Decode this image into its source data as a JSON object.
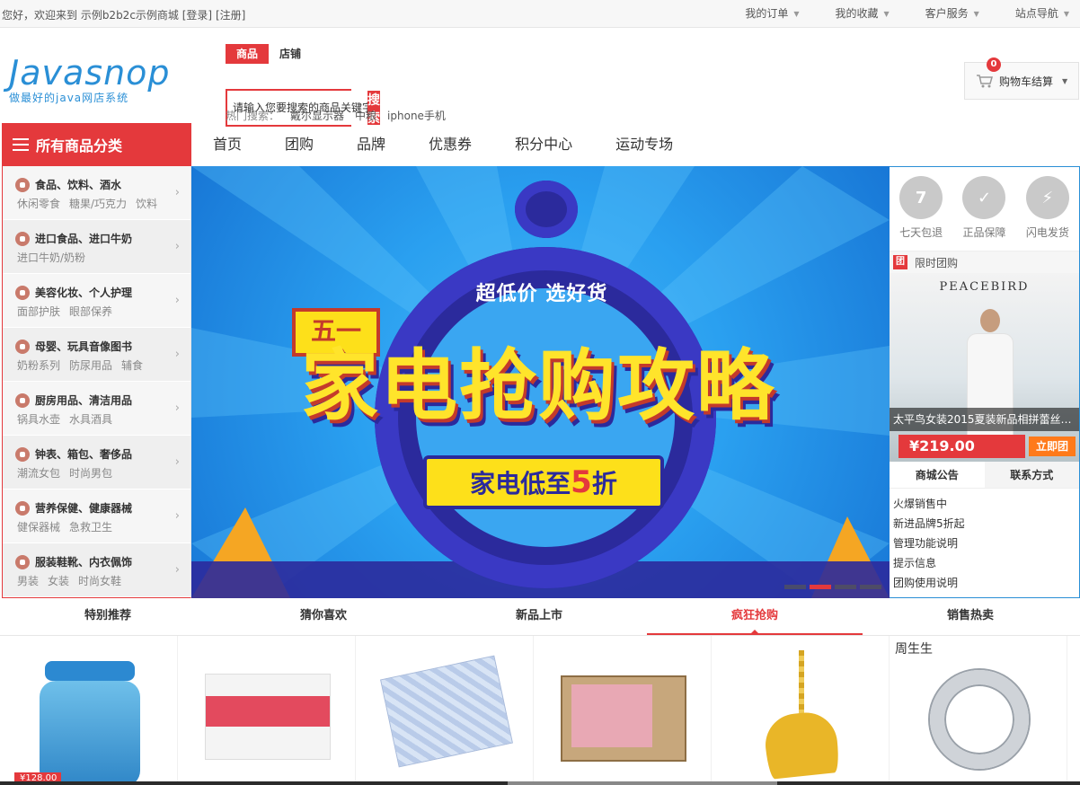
{
  "topbar": {
    "welcome": "您好，欢迎来到 示例b2b2c示例商城",
    "login": "[登录]",
    "register": "[注册]",
    "links": [
      "我的订单",
      "我的收藏",
      "客户服务",
      "站点导航"
    ]
  },
  "logo": {
    "word": "Javasnop",
    "slogan": "做最好的java网店系统"
  },
  "search": {
    "tabs": [
      "商品",
      "店铺"
    ],
    "placeholder": "请输入您要搜索的商品关键字",
    "button": "搜索",
    "hot_label": "热门搜索：",
    "hot_words": [
      "戴尔显示器",
      "中粮",
      "iphone手机"
    ]
  },
  "cart": {
    "count": "0",
    "label": "购物车结算"
  },
  "categories_button": "所有商品分类",
  "main_nav": [
    "首页",
    "团购",
    "品牌",
    "优惠券",
    "积分中心",
    "运动专场"
  ],
  "categories": [
    {
      "title": "食品、饮料、酒水",
      "subs": [
        "休闲零食",
        "糖果/巧克力",
        "饮料"
      ]
    },
    {
      "title": "进口食品、进口牛奶",
      "subs": [
        "进口牛奶/奶粉"
      ]
    },
    {
      "title": "美容化妆、个人护理",
      "subs": [
        "面部护肤",
        "眼部保养"
      ]
    },
    {
      "title": "母婴、玩具音像图书",
      "subs": [
        "奶粉系列",
        "防尿用品",
        "辅食"
      ]
    },
    {
      "title": "厨房用品、清洁用品",
      "subs": [
        "锅具水壶",
        "水具酒具"
      ]
    },
    {
      "title": "钟表、箱包、奢侈品",
      "subs": [
        "潮流女包",
        "时尚男包"
      ]
    },
    {
      "title": "营养保健、健康器械",
      "subs": [
        "健保器械",
        "急救卫生"
      ]
    },
    {
      "title": "服装鞋靴、内衣佩饰",
      "subs": [
        "男装",
        "女装",
        "时尚女鞋"
      ]
    }
  ],
  "banner": {
    "tag": "五一",
    "subtitle": "超低价 选好货",
    "headline": "家电抢购攻略",
    "ribbon_prefix": "家电低至",
    "ribbon_number": "5",
    "ribbon_suffix": "折"
  },
  "guarantees": [
    {
      "label": "七天包退",
      "glyph": "7"
    },
    {
      "label": "正品保障",
      "glyph": "✓"
    },
    {
      "label": "闪电发货",
      "glyph": "⚡"
    }
  ],
  "group_buy": {
    "badge": "团",
    "heading": "限时团购",
    "brand": "PEACEBIRD",
    "title": "太平鸟女装2015夏装新品相拼蕾丝…",
    "price": "¥219.00",
    "button": "立即团"
  },
  "notice": {
    "tabs": [
      "商城公告",
      "联系方式"
    ],
    "items": [
      "火爆销售中",
      "新进品牌5折起",
      "管理功能说明",
      "提示信息",
      "团购使用说明"
    ]
  },
  "product_tabs": [
    "特别推荐",
    "猜你喜欢",
    "新品上市",
    "疯狂抢购",
    "销售热卖"
  ],
  "product_extra": {
    "ring_brand": "周生生",
    "first_price": "¥128.00"
  }
}
